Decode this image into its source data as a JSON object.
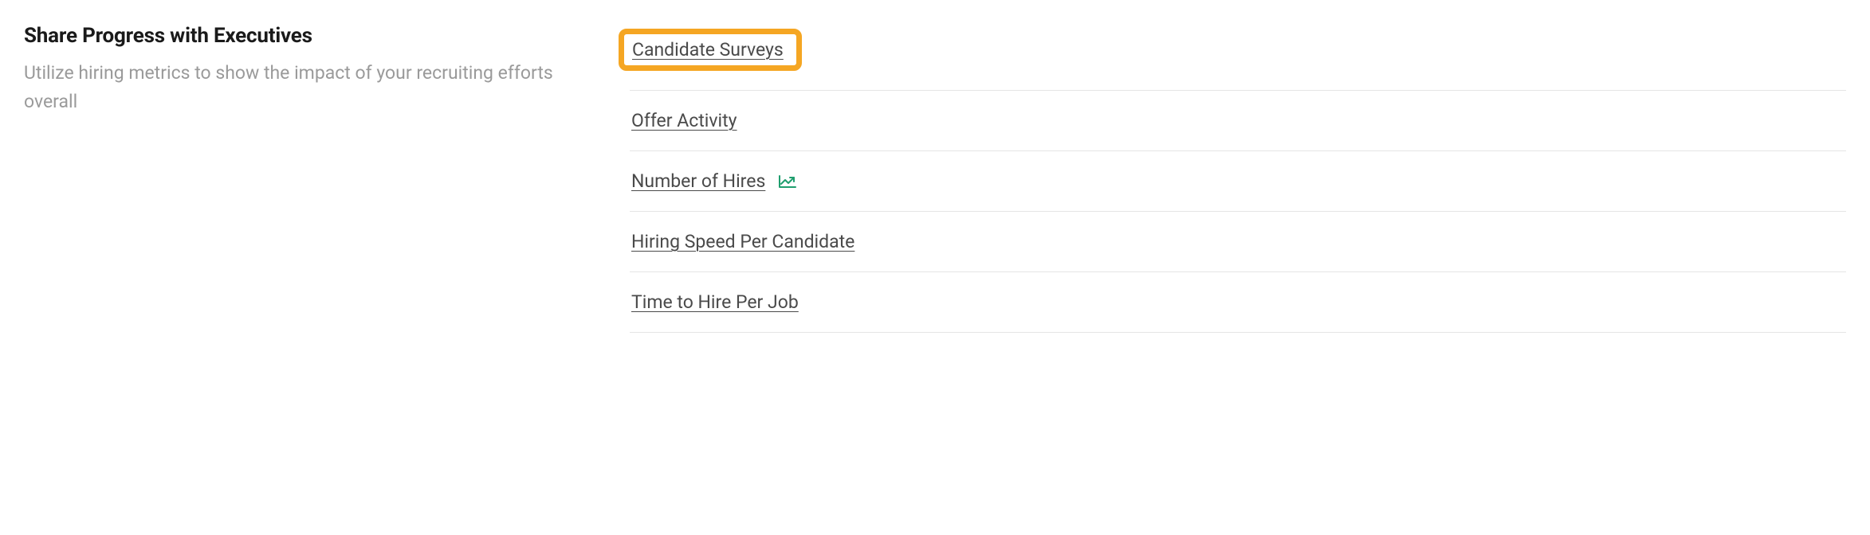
{
  "section": {
    "title": "Share Progress with Executives",
    "description": "Utilize hiring metrics to show the impact of your recruiting efforts overall"
  },
  "links": {
    "candidate_surveys": {
      "label": "Candidate Surveys",
      "highlighted": true,
      "has_trend_icon": false
    },
    "offer_activity": {
      "label": "Offer Activity",
      "highlighted": false,
      "has_trend_icon": false
    },
    "number_of_hires": {
      "label": "Number of Hires",
      "highlighted": false,
      "has_trend_icon": true
    },
    "hiring_speed": {
      "label": "Hiring Speed Per Candidate",
      "highlighted": false,
      "has_trend_icon": false
    },
    "time_to_hire": {
      "label": "Time to Hire Per Job",
      "highlighted": false,
      "has_trend_icon": false
    }
  }
}
